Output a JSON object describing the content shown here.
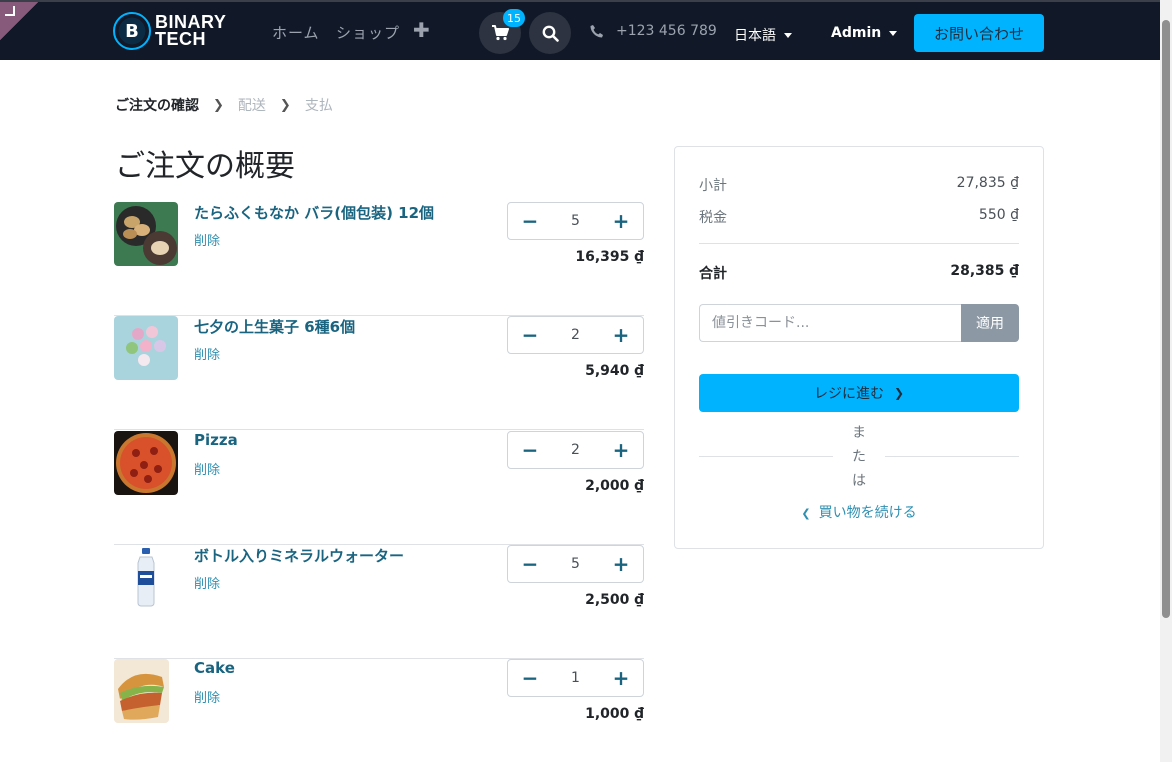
{
  "header": {
    "logo_line1": "BINARY",
    "logo_line2": "TECH",
    "logo_letter": "B",
    "nav": [
      {
        "label": "ホーム"
      },
      {
        "label": "ショップ"
      }
    ],
    "add_icon": "plus-icon",
    "cart_count": "15",
    "phone": "+123 456 789",
    "language": "日本語",
    "user": "Admin",
    "contact_label": "お問い合わせ"
  },
  "breadcrumb": {
    "step1": "ご注文の確認",
    "step2": "配送",
    "step3": "支払"
  },
  "page_title": "ご注文の概要",
  "cart": {
    "remove_label": "削除",
    "lines": [
      {
        "name": "たらふくもなか バラ(個包装) 12個",
        "qty": "5",
        "price": "16,395 ₫"
      },
      {
        "name": "七夕の上生菓子 6種6個",
        "qty": "2",
        "price": "5,940 ₫"
      },
      {
        "name": "Pizza",
        "qty": "2",
        "price": "2,000 ₫"
      },
      {
        "name": "ボトル入りミネラルウォーター",
        "qty": "5",
        "price": "2,500 ₫"
      },
      {
        "name": "Cake",
        "qty": "1",
        "price": "1,000 ₫"
      }
    ]
  },
  "summary": {
    "subtotal_label": "小計",
    "subtotal_value": "27,835 ₫",
    "tax_label": "税金",
    "tax_value": "550 ₫",
    "total_label": "合計",
    "total_value": "28,385 ₫",
    "promo_placeholder": "値引きコード...",
    "promo_button": "適用",
    "checkout_label": "レジに進む",
    "or_label": "または",
    "continue_label": "買い物を続ける"
  },
  "colors": {
    "navbar": "#111827",
    "accent": "#00b3ff",
    "link": "#1a6480"
  }
}
